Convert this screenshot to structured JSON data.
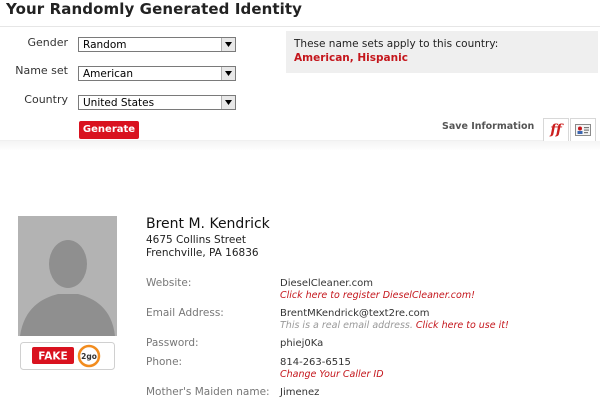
{
  "header": {
    "title": "Your Randomly Generated Identity"
  },
  "form": {
    "gender_label": "Gender",
    "gender_value": "Random",
    "nameset_label": "Name set",
    "nameset_value": "American",
    "country_label": "Country",
    "country_value": "United States",
    "generate_label": "Generate"
  },
  "notice": {
    "text": "These name sets apply to this country:",
    "links": "American, Hispanic"
  },
  "toolbar": {
    "save_label": "Save Information",
    "ff_label": "ff"
  },
  "identity": {
    "name": "Brent M. Kendrick",
    "street": "4675 Collins Street",
    "city": "Frenchville, PA 16836"
  },
  "details": {
    "website_label": "Website:",
    "website_value": "DieselCleaner.com",
    "website_link": "Click here to register DieselCleaner.com!",
    "email_label": "Email Address:",
    "email_value": "BrentMKendrick@text2re.com",
    "email_note": "This is a real email address.",
    "email_link": "Click here to use it!",
    "password_label": "Password:",
    "password_value": "phiej0Ka",
    "phone_label": "Phone:",
    "phone_value": "814-263-6515",
    "phone_link": "Change Your Caller ID",
    "maiden_label": "Mother's Maiden name:",
    "maiden_value": "Jimenez"
  },
  "badge": {
    "fake_text": "FAKE",
    "togo_text": "2go"
  },
  "colors": {
    "accent_red": "#d9121f",
    "link_red": "#c4161c",
    "avatar_gray": "#b5b5b5"
  }
}
